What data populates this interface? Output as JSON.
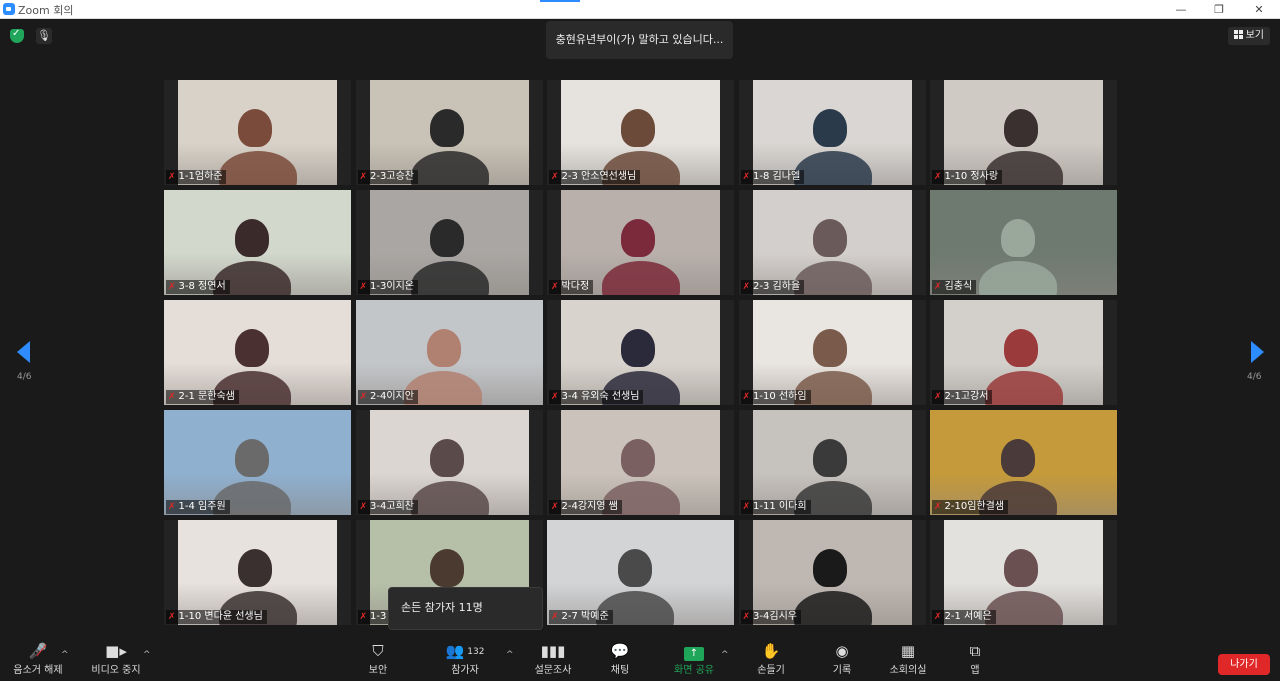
{
  "window": {
    "title": "Zoom 회의",
    "minimize": "—",
    "restore": "❐",
    "close": "✕"
  },
  "meeting": {
    "speaking_banner": "충현유년부이(가) 말하고 있습니다...",
    "view_label": "보기",
    "page_indicator": "4/6",
    "raised_hands_tooltip": "손든 참가자 11명"
  },
  "tiles": [
    {
      "name": "1-1엄하준",
      "bg": "#d8d2c8",
      "fg": "#7a4a3a",
      "full": false
    },
    {
      "name": "2-3고승찬",
      "bg": "#c9c2b6",
      "fg": "#2a2a2a",
      "full": false
    },
    {
      "name": "2-3 안소연선생님",
      "bg": "#e6e3de",
      "fg": "#6b4a3a",
      "full": false
    },
    {
      "name": "1-8 김나엘",
      "bg": "#d9d6d3",
      "fg": "#2b3a4a",
      "full": false
    },
    {
      "name": "1-10 정사랑",
      "bg": "#cfcac4",
      "fg": "#3a3030",
      "full": false
    },
    {
      "name": "3-8 정연서",
      "bg": "#d2d8cc",
      "fg": "#3a2a2a",
      "full": true
    },
    {
      "name": "1-3이지온",
      "bg": "#a9a6a3",
      "fg": "#2a2a2a",
      "full": false
    },
    {
      "name": "박다정",
      "bg": "#b9b0ab",
      "fg": "#7a2a3a",
      "full": false
    },
    {
      "name": "2-3 김하율",
      "bg": "#d3cfcc",
      "fg": "#6a5a5a",
      "full": false
    },
    {
      "name": "김충식",
      "bg": "#6e7a70",
      "fg": "#9aa89c",
      "full": true
    },
    {
      "name": "2-1 문한숙샘",
      "bg": "#e4ddd8",
      "fg": "#4a3030",
      "full": true
    },
    {
      "name": "2-4이지안",
      "bg": "#c3c6c9",
      "fg": "#b08070",
      "full": true
    },
    {
      "name": "3-4 유외숙 선생님",
      "bg": "#d9d3ce",
      "fg": "#2a2a3a",
      "full": false
    },
    {
      "name": "1-10 선하임",
      "bg": "#e9e5e0",
      "fg": "#7a5a4a",
      "full": false
    },
    {
      "name": "2-1고강서",
      "bg": "#d3d0cc",
      "fg": "#9a3a3a",
      "full": false
    },
    {
      "name": "1-4 임주원",
      "bg": "#8fb0cf",
      "fg": "#6a6a6a",
      "full": true
    },
    {
      "name": "3-4고희찬",
      "bg": "#dcd6d3",
      "fg": "#5a4a4a",
      "full": false
    },
    {
      "name": "2-4강지영 쌤",
      "bg": "#cbc3bb",
      "fg": "#7a6060",
      "full": false
    },
    {
      "name": "1-11 이다희",
      "bg": "#c6c2be",
      "fg": "#3a3a3a",
      "full": false
    },
    {
      "name": "2-10임한결샘",
      "bg": "#c59a3a",
      "fg": "#4a3a3a",
      "full": true
    },
    {
      "name": "1-10 변다윤 선생님",
      "bg": "#e8e2df",
      "fg": "#3a3030",
      "full": false
    },
    {
      "name": "1-3",
      "bg": "#b6bfa8",
      "fg": "#4a3a30",
      "full": false
    },
    {
      "name": "2-7 박예준",
      "bg": "#d2d4d6",
      "fg": "#4a4a4a",
      "full": true
    },
    {
      "name": "3-4김시우",
      "bg": "#bfb8b2",
      "fg": "#1a1a1a",
      "full": false
    },
    {
      "name": "2-1 서예은",
      "bg": "#e3e1de",
      "fg": "#6a5050",
      "full": false
    }
  ],
  "toolbar": {
    "unmute": "음소거 해제",
    "video": "비디오 중지",
    "security": "보안",
    "participants": "참가자",
    "participant_count": "132",
    "polls": "설문조사",
    "chat": "채팅",
    "share": "화면 공유",
    "record_listen": "손들기",
    "record": "기록",
    "breakout": "소회의실",
    "apps": "앱",
    "leave": "나가기"
  },
  "colors": {
    "accent": "#2d8cff",
    "leave": "#e02828",
    "share": "#1fa65a"
  }
}
